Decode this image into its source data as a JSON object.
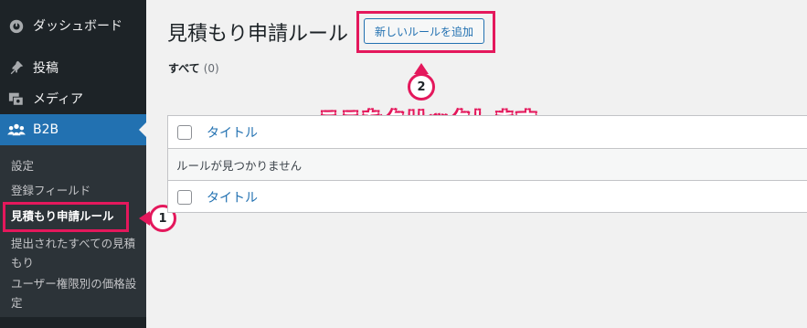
{
  "sidebar": {
    "items": [
      {
        "label": "ダッシュボード",
        "icon": "dashboard-icon"
      },
      {
        "label": "投稿",
        "icon": "pin-icon"
      },
      {
        "label": "メディア",
        "icon": "media-icon"
      },
      {
        "label": "B2B",
        "icon": "groups-icon"
      }
    ],
    "submenu": [
      {
        "label": "設定"
      },
      {
        "label": "登録フィールド"
      },
      {
        "label": "見積もり申請ルール"
      },
      {
        "label": "提出されたすべての見積もり"
      },
      {
        "label": "ユーザー権限別の価格設定"
      }
    ]
  },
  "main": {
    "page_title": "見積もり申請ルール",
    "add_button": "新しいルールを追加",
    "filter_all": "すべて",
    "filter_count": "(0)",
    "table": {
      "column_title": "タイトル",
      "empty_message": "ルールが見つかりません",
      "footer_title": "タイトル"
    }
  },
  "annotations": {
    "step1": "1",
    "step2": "2",
    "instruction": "ここをクリックします"
  },
  "colors": {
    "sidebar_bg": "#1d2327",
    "submenu_bg": "#2c3338",
    "active_bg": "#2271b1",
    "highlight": "#e4185c",
    "link": "#2271b1"
  }
}
